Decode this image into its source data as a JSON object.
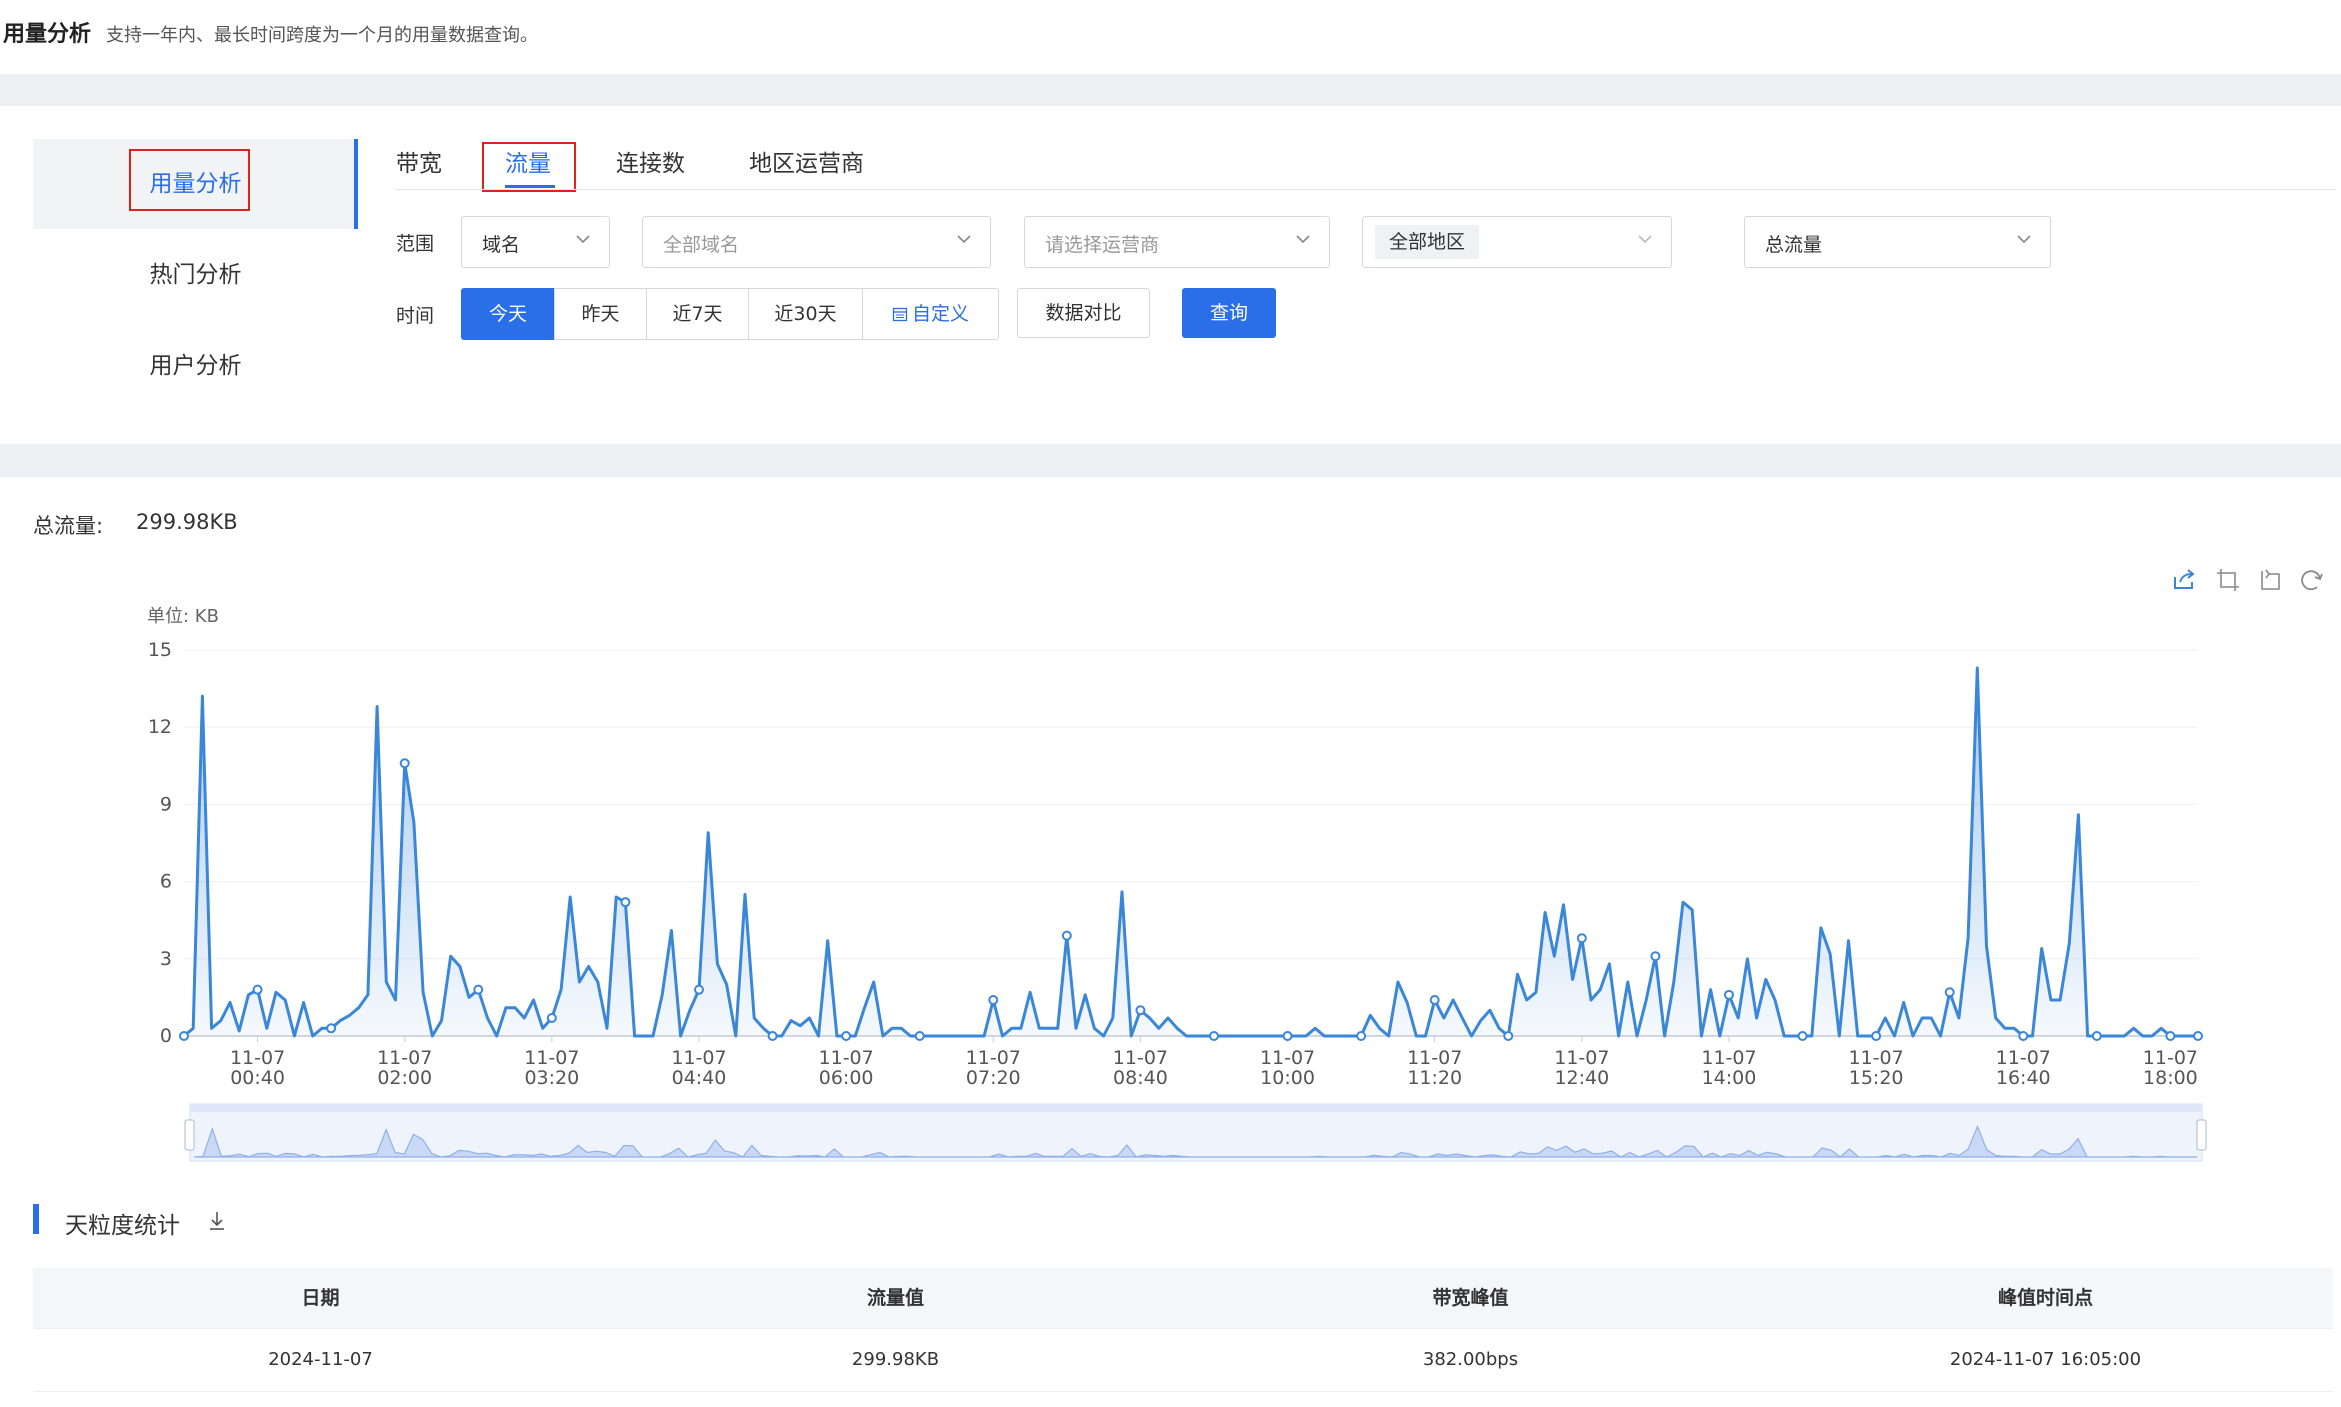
{
  "header": {
    "title": "用量分析",
    "description": "支持一年内、最长时间跨度为一个月的用量数据查询。"
  },
  "sidebar": {
    "items": [
      {
        "label": "用量分析",
        "active": true
      },
      {
        "label": "热门分析",
        "active": false
      },
      {
        "label": "用户分析",
        "active": false
      }
    ]
  },
  "tabs": [
    {
      "label": "带宽",
      "active": false
    },
    {
      "label": "流量",
      "active": true
    },
    {
      "label": "连接数",
      "active": false
    },
    {
      "label": "地区运营商",
      "active": false
    }
  ],
  "filters": {
    "scope_label": "范围",
    "scope_type": "域名",
    "domain_placeholder": "全部域名",
    "isp_placeholder": "请选择运营商",
    "region_value": "全部地区",
    "metric_value": "总流量",
    "time_label": "时间",
    "time_options": [
      "今天",
      "昨天",
      "近7天",
      "近30天"
    ],
    "time_selected": "今天",
    "custom_label": "自定义",
    "compare_button": "数据对比",
    "query_button": "查询"
  },
  "summary": {
    "total_label": "总流量:",
    "total_value": "299.98KB"
  },
  "toolbar_icons": [
    "export-icon",
    "crop-icon",
    "crop-reset-icon",
    "refresh-icon"
  ],
  "colors": {
    "accent": "#2a6ee8",
    "line": "#3a86d8",
    "highlight_box": "#e0221f"
  },
  "chart_data": {
    "type": "area",
    "unit_label": "单位: KB",
    "ylim": [
      0,
      15
    ],
    "y_ticks": [
      0,
      3,
      6,
      9,
      12,
      15
    ],
    "x_range": [
      "11-07 00:00",
      "11-07 18:00"
    ],
    "x_ticks": [
      [
        "11-07",
        "00:40"
      ],
      [
        "11-07",
        "02:00"
      ],
      [
        "11-07",
        "03:20"
      ],
      [
        "11-07",
        "04:40"
      ],
      [
        "11-07",
        "06:00"
      ],
      [
        "11-07",
        "07:20"
      ],
      [
        "11-07",
        "08:40"
      ],
      [
        "11-07",
        "10:00"
      ],
      [
        "11-07",
        "11:20"
      ],
      [
        "11-07",
        "12:40"
      ],
      [
        "11-07",
        "14:00"
      ],
      [
        "11-07",
        "15:20"
      ],
      [
        "11-07",
        "16:40"
      ],
      [
        "11-07",
        "18:00"
      ]
    ],
    "interval_minutes": 5,
    "grid": true,
    "series": [
      {
        "values": [
          0,
          0.3,
          13.2,
          0.3,
          0.6,
          1.3,
          0.2,
          1.6,
          1.8,
          0.3,
          1.7,
          1.4,
          0,
          1.3,
          0,
          0.3,
          0.3,
          0.6,
          0.8,
          1.1,
          1.6,
          12.8,
          2.1,
          1.4,
          10.6,
          8.3,
          1.7,
          0,
          0.6,
          3.1,
          2.7,
          1.5,
          1.8,
          0.7,
          0,
          1.1,
          1.1,
          0.7,
          1.4,
          0.3,
          0.7,
          1.8,
          5.4,
          2.1,
          2.7,
          2.1,
          0.3,
          5.4,
          5.2,
          0,
          0,
          0,
          1.6,
          4.1,
          0,
          1,
          1.8,
          7.9,
          2.8,
          2,
          0,
          5.5,
          0.7,
          0.3,
          0,
          0,
          0.6,
          0.4,
          0.7,
          0,
          3.7,
          0,
          0,
          0,
          1.1,
          2.1,
          0,
          0.3,
          0.3,
          0,
          0,
          0,
          0,
          0,
          0,
          0,
          0,
          0,
          1.4,
          0,
          0.3,
          0.3,
          1.7,
          0.3,
          0.3,
          0.3,
          3.9,
          0.3,
          1.6,
          0.3,
          0,
          0.7,
          5.6,
          0,
          1,
          0.7,
          0.3,
          0.7,
          0.3,
          0,
          0,
          0,
          0,
          0,
          0,
          0,
          0,
          0,
          0,
          0,
          0,
          0,
          0,
          0.3,
          0,
          0,
          0,
          0,
          0,
          0.8,
          0.3,
          0,
          2.1,
          1.3,
          0,
          0,
          1.4,
          0.7,
          1.4,
          0.7,
          0,
          0.6,
          1,
          0.3,
          0,
          2.4,
          1.4,
          1.7,
          4.8,
          3.1,
          5.1,
          2.2,
          3.8,
          1.4,
          1.8,
          2.8,
          0,
          2.1,
          0,
          1.4,
          3.1,
          0,
          2.1,
          5.2,
          4.9,
          0,
          1.8,
          0,
          1.6,
          0.7,
          3,
          0.7,
          2.2,
          1.4,
          0,
          0,
          0,
          0,
          4.2,
          3.2,
          0,
          3.7,
          0,
          0,
          0,
          0.7,
          0,
          1.3,
          0,
          0.7,
          0.7,
          0,
          1.7,
          0.7,
          3.8,
          14.3,
          3.5,
          0.7,
          0.3,
          0.3,
          0,
          0,
          3.4,
          1.4,
          1.4,
          3.6,
          8.6,
          0,
          0,
          0,
          0,
          0,
          0.3,
          0,
          0,
          0.3,
          0,
          0,
          0,
          0
        ]
      }
    ]
  },
  "daily_stats": {
    "title": "天粒度统计",
    "columns": [
      "日期",
      "流量值",
      "带宽峰值",
      "峰值时间点"
    ],
    "rows": [
      [
        "2024-11-07",
        "299.98KB",
        "382.00bps",
        "2024-11-07 16:05:00"
      ]
    ]
  }
}
